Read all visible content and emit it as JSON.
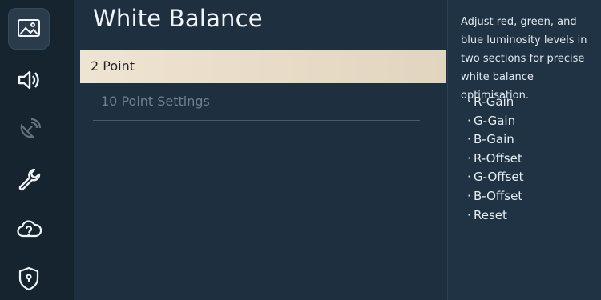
{
  "sidebar": {
    "items": [
      {
        "name": "picture",
        "icon": "picture-icon",
        "active": true
      },
      {
        "name": "sound",
        "icon": "speaker-icon",
        "active": false
      },
      {
        "name": "broadcasting",
        "icon": "satellite-dish-icon",
        "active": false
      },
      {
        "name": "general",
        "icon": "wrench-icon",
        "active": false
      },
      {
        "name": "support",
        "icon": "cloud-question-icon",
        "active": false
      },
      {
        "name": "privacy",
        "icon": "shield-icon",
        "active": false
      }
    ]
  },
  "page": {
    "title": "White Balance",
    "menu": [
      {
        "label": "2 Point",
        "state": "selected"
      },
      {
        "label": "10 Point Settings",
        "state": "disabled"
      }
    ]
  },
  "help": {
    "description": "Adjust red, green, and blue luminosity levels in two sections for precise white balance optimisation.",
    "bullets": [
      "R-Gain",
      "G-Gain",
      "B-Gain",
      "R-Offset",
      "G-Offset",
      "B-Offset",
      "Reset"
    ]
  },
  "colors": {
    "background": "#1e3040",
    "rail": "#16242f",
    "selected": "#e8dcc8",
    "disabled_text": "#6e7f8e"
  }
}
